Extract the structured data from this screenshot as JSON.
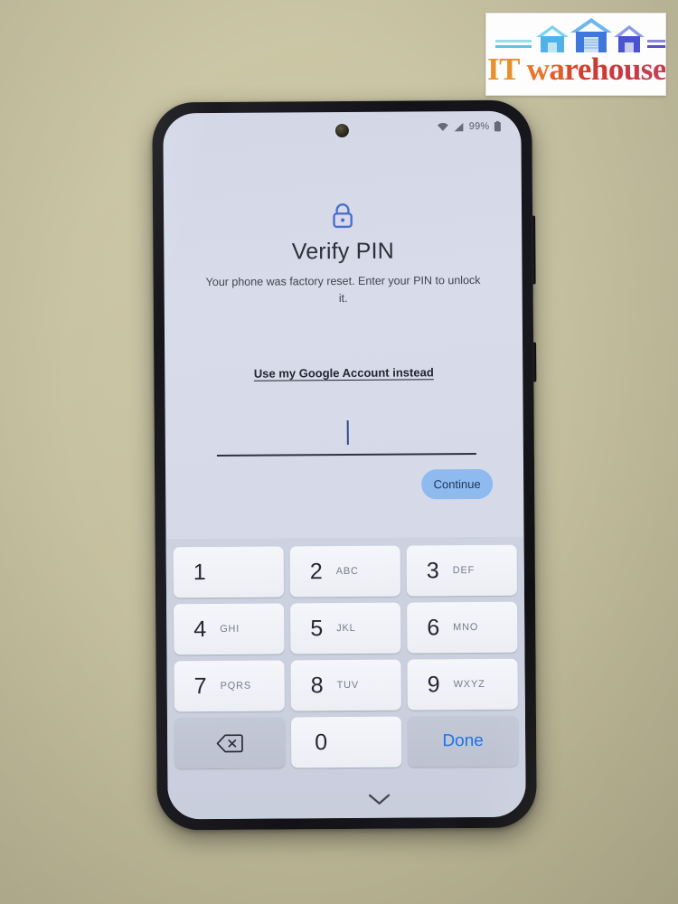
{
  "watermark": {
    "name": "IT warehouse",
    "word_parts": [
      "IT",
      " ",
      "w",
      "a",
      "r",
      "e",
      "h",
      "o",
      "u",
      "s",
      "e"
    ],
    "colors": {
      "it": "#e8912c",
      "house_left": "#5bb7e8",
      "house_center": "#4b7fe0",
      "house_right": "#5a5fd6",
      "line_left": "#6fd0e0",
      "line_right": "#6a62c8"
    }
  },
  "phone": {
    "status_bar": {
      "battery_percent": "99%",
      "icons": [
        "wifi-icon",
        "signal-icon",
        "battery-icon"
      ]
    },
    "screen": {
      "lock_icon": "lock-icon",
      "lock_icon_color": "#4a6fd0",
      "title": "Verify PIN",
      "subtitle": "Your phone was factory reset. Enter your PIN to unlock it.",
      "google_account_link": "Use my Google Account instead",
      "pin_input": {
        "value": "",
        "placeholder": ""
      },
      "continue_button": {
        "label": "Continue",
        "color": "#8ebaf0"
      },
      "keypad": {
        "rows": [
          [
            {
              "digit": "1",
              "letters": "",
              "style": "light",
              "name": "key-1"
            },
            {
              "digit": "2",
              "letters": "ABC",
              "style": "light",
              "name": "key-2"
            },
            {
              "digit": "3",
              "letters": "DEF",
              "style": "light",
              "name": "key-3"
            }
          ],
          [
            {
              "digit": "4",
              "letters": "GHI",
              "style": "light",
              "name": "key-4"
            },
            {
              "digit": "5",
              "letters": "JKL",
              "style": "light",
              "name": "key-5"
            },
            {
              "digit": "6",
              "letters": "MNO",
              "style": "light",
              "name": "key-6"
            }
          ],
          [
            {
              "digit": "7",
              "letters": "PQRS",
              "style": "light",
              "name": "key-7"
            },
            {
              "digit": "8",
              "letters": "TUV",
              "style": "light",
              "name": "key-8"
            },
            {
              "digit": "9",
              "letters": "WXYZ",
              "style": "light",
              "name": "key-9"
            }
          ]
        ],
        "bottom_row": {
          "backspace_icon": "backspace-icon",
          "zero": "0",
          "done_label": "Done",
          "done_color": "#1a73e8"
        }
      },
      "dismiss_keyboard_icon": "chevron-down-icon"
    }
  }
}
